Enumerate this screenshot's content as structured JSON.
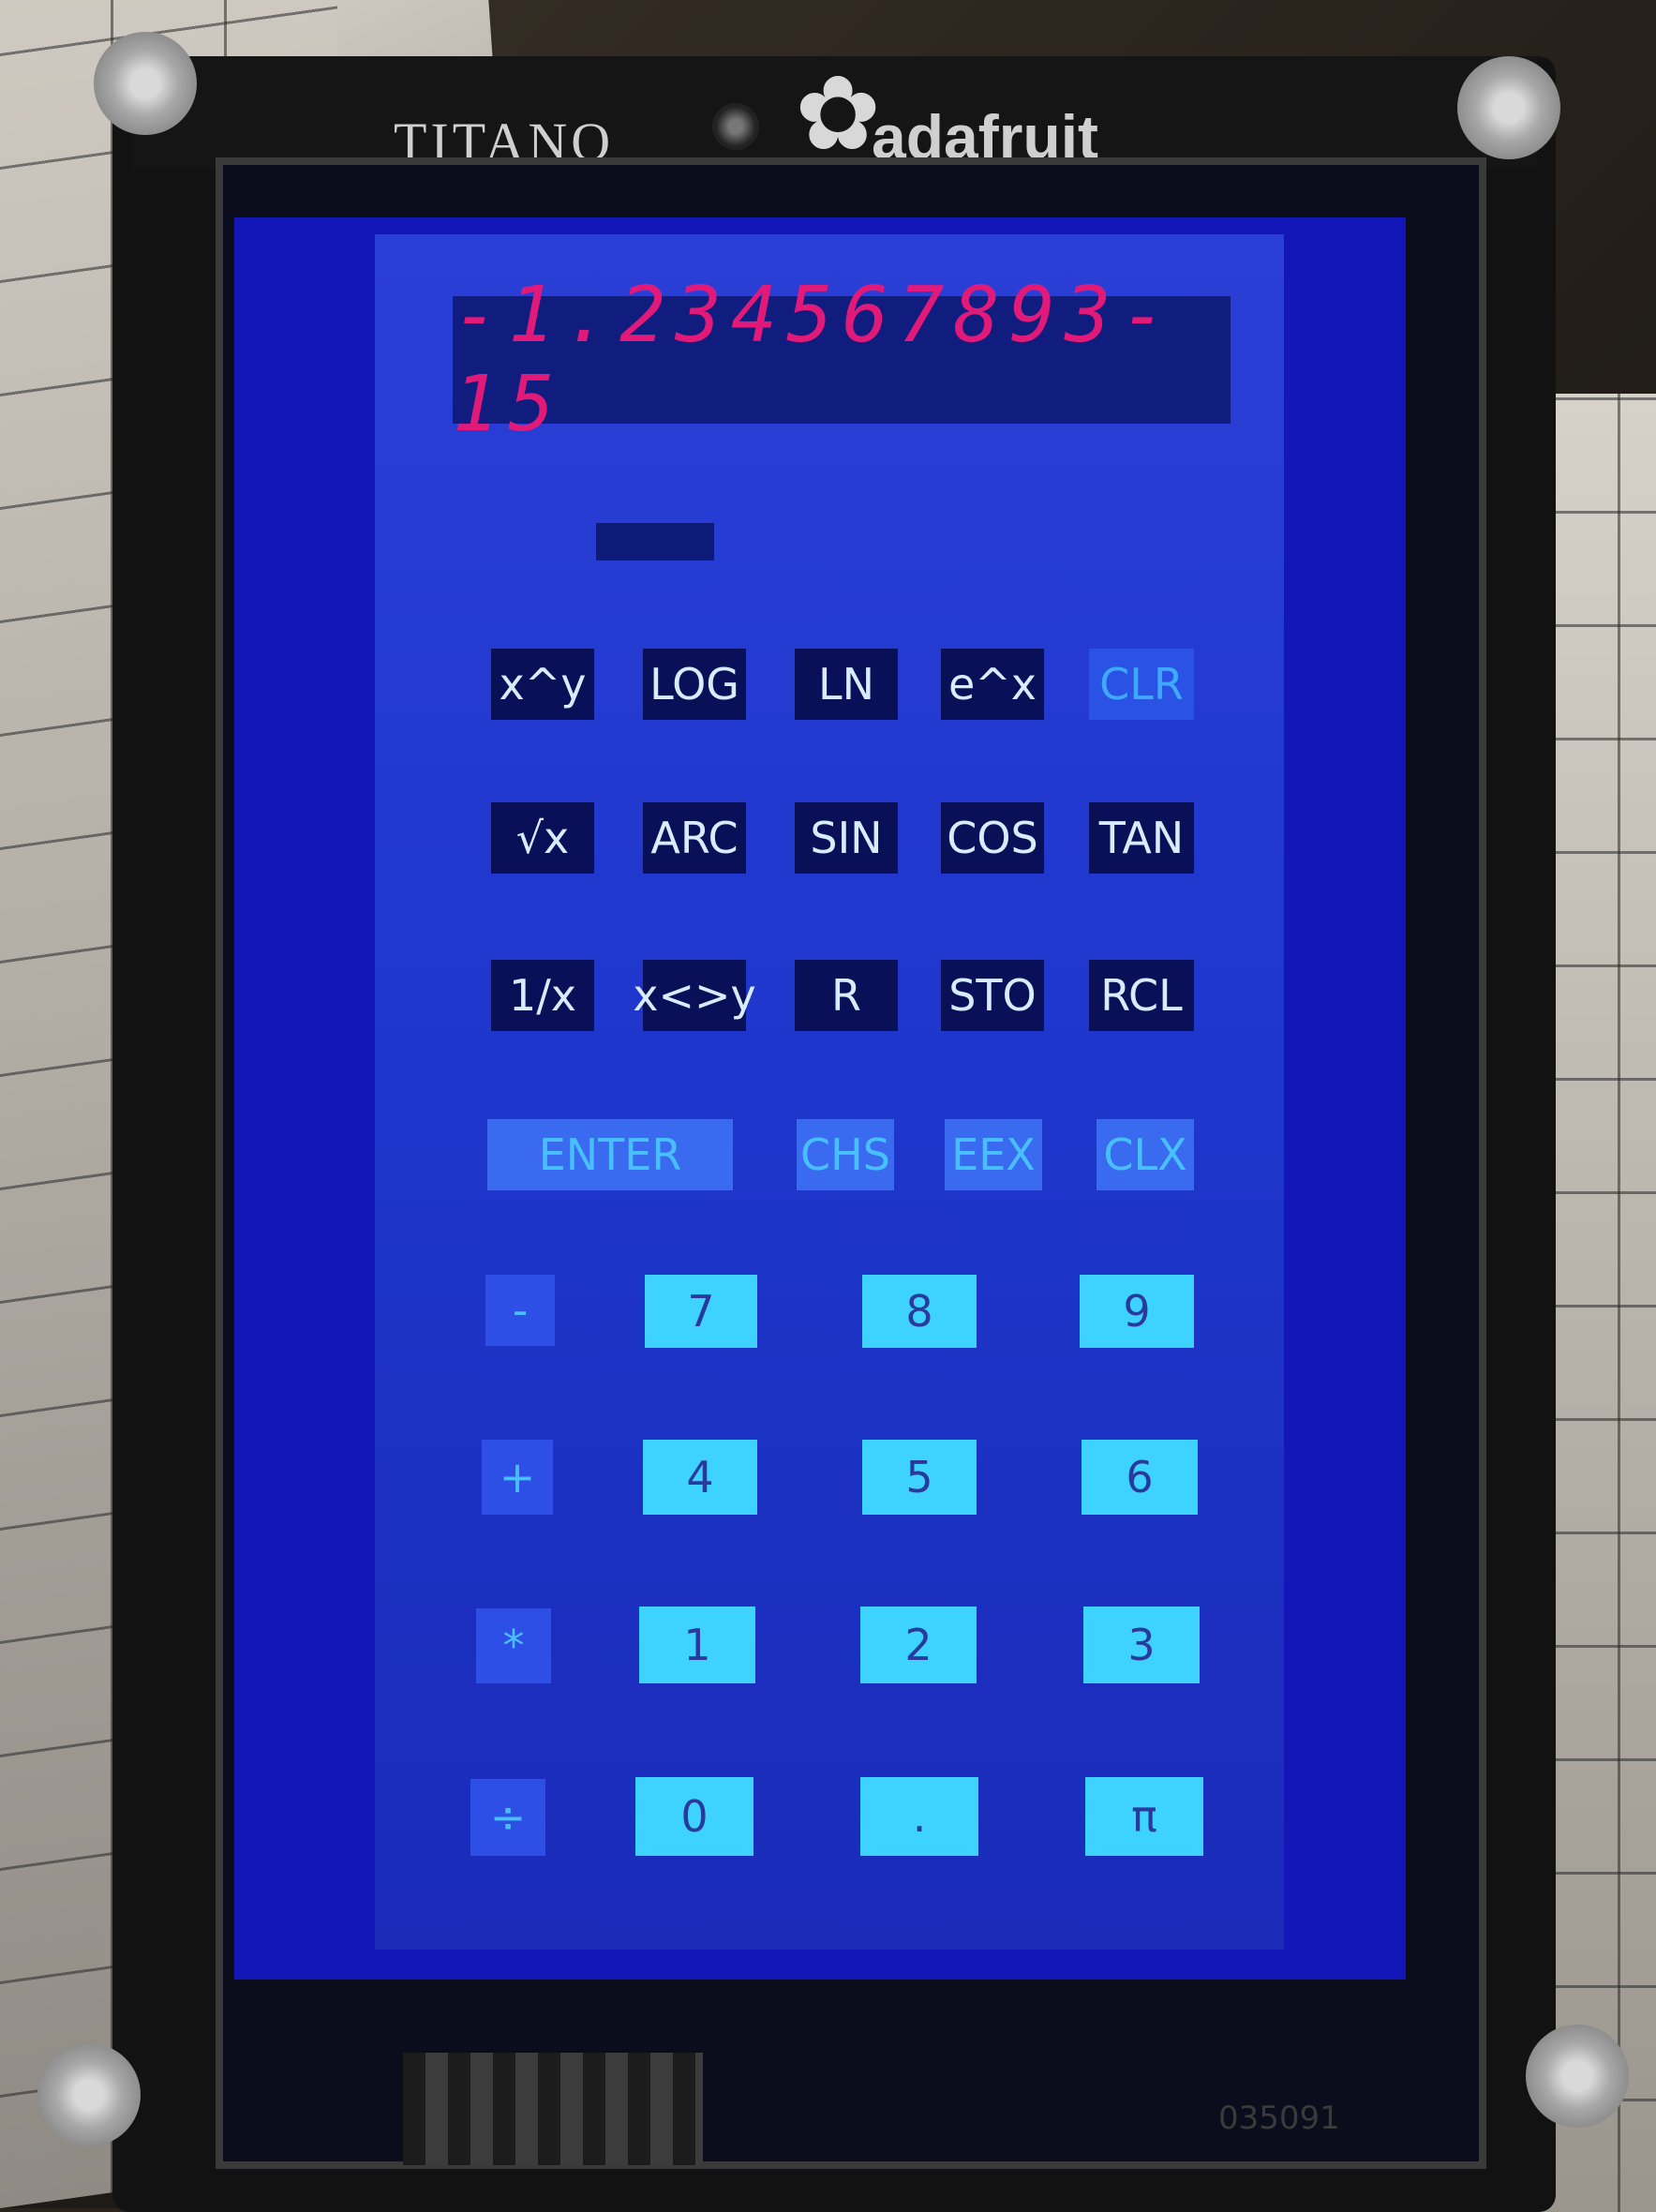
{
  "branding": {
    "left_label": "TITANO",
    "right_label": "adafruit"
  },
  "display": {
    "readout": "-1.234567893-15"
  },
  "keys": {
    "row1": [
      "x^y",
      "LOG",
      "LN",
      "e^x",
      "CLR"
    ],
    "row2": [
      "√x",
      "ARC",
      "SIN",
      "COS",
      "TAN"
    ],
    "row3": [
      "1/x",
      "x<>y",
      "R",
      "STO",
      "RCL"
    ],
    "row4": [
      "ENTER",
      "CHS",
      "EEX",
      "CLX"
    ],
    "ops": [
      "-",
      "+",
      "*",
      "÷"
    ],
    "digits_row1": [
      "7",
      "8",
      "9"
    ],
    "digits_row2": [
      "4",
      "5",
      "6"
    ],
    "digits_row3": [
      "1",
      "2",
      "3"
    ],
    "digits_row4": [
      "0",
      ".",
      "π"
    ]
  },
  "board_text": {
    "serial": "035091"
  },
  "colors": {
    "screen_blue": "#1417b8",
    "display_text": "#e11a7a",
    "digit_key": "#3ed2ff",
    "function_key": "#0a1058"
  }
}
